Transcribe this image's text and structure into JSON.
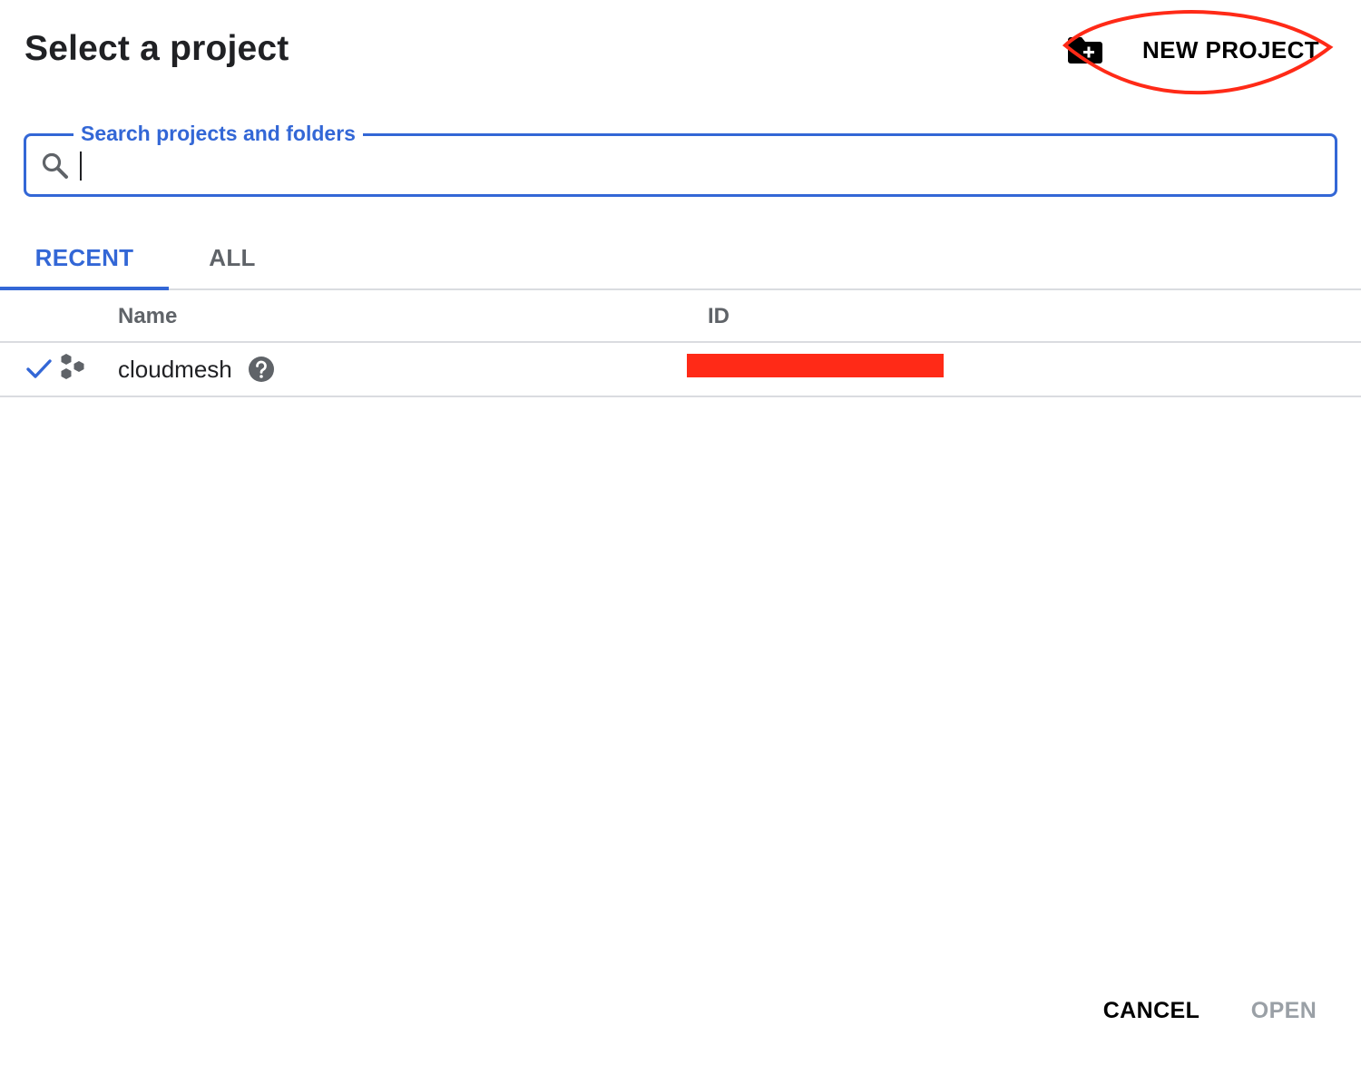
{
  "dialog": {
    "title": "Select a project",
    "new_project_label": "NEW PROJECT",
    "new_project_icon": "new-project-folder-icon",
    "annotation_color": "#ff2a17"
  },
  "search": {
    "label": "Search projects and folders",
    "value": "",
    "placeholder": "",
    "icon": "search-icon",
    "accent_color": "#3367d6"
  },
  "tabs": [
    {
      "label": "RECENT",
      "active": true
    },
    {
      "label": "ALL",
      "active": false
    }
  ],
  "table": {
    "columns": [
      "Name",
      "ID"
    ],
    "rows": [
      {
        "selected": true,
        "name": "cloudmesh",
        "id": "",
        "id_redacted": true,
        "icons": [
          "check-icon",
          "project-icon",
          "help-icon"
        ]
      }
    ]
  },
  "footer": {
    "cancel_label": "CANCEL",
    "open_label": "OPEN",
    "open_enabled": false
  }
}
